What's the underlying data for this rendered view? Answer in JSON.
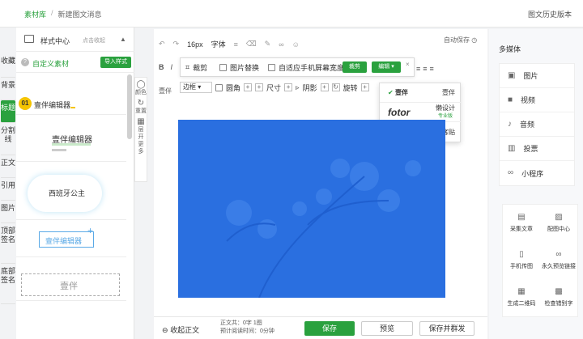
{
  "breadcrumb": {
    "root": "素材库",
    "sep": "/",
    "current": "新建图文消息"
  },
  "history_label": "图文历史版本",
  "left_tabs": [
    "收藏",
    "背景",
    "标题",
    "分割线",
    "正文",
    "引用",
    "图片",
    "顶部签名",
    "底部签名"
  ],
  "active_tab_index": 2,
  "style_panel": {
    "title": "样式中心",
    "collapse_label": "点击收起",
    "custom_label": "自定义素材",
    "import_label": "导入样式",
    "cards": [
      {
        "num": "01",
        "text": "壹伴编辑器"
      },
      {
        "text": "壹伴编辑器"
      },
      {
        "text": "西班牙公主"
      },
      {
        "text": "壹伴编辑器"
      },
      {
        "text": "壹伴"
      }
    ]
  },
  "icon_column": [
    {
      "label": "颜色",
      "icon": "palette-icon"
    },
    {
      "label": "重置",
      "icon": "reset-icon"
    },
    {
      "label": "层开更多",
      "icon": "more-icon"
    }
  ],
  "editor": {
    "autosave_label": "自动保存",
    "toolbar1": [
      "16px",
      "字体"
    ],
    "toolbar2_label": "壹伴",
    "image_toolbar": {
      "crop_label": "裁剪",
      "replace_label": "图片替换",
      "fit_label": "自适应手机屏幕宽度",
      "crop_btn": "裁剪",
      "edit_btn": "编辑"
    },
    "image_toolbar2": {
      "border_label": "边框",
      "round_label": "圆角",
      "size_label": "尺寸",
      "shadow_label": "阴影",
      "rotate_label": "旋转"
    },
    "dropdown": [
      {
        "brand": "壹伴",
        "label": "壹伴"
      },
      {
        "brand": "fotor",
        "label": "懒设计",
        "sub": "专业版"
      },
      {
        "brand": "创客贴logo",
        "label": "创客贴"
      }
    ]
  },
  "bottom_bar": {
    "collapse_text": "收起正文",
    "stats_line1": "正文共：0字 1图",
    "stats_line2": "预计阅读时间：0分钟",
    "save_label": "保存",
    "preview_label": "预览",
    "save_send_label": "保存并群发"
  },
  "right_panel": {
    "media_title": "多媒体",
    "media_items": [
      {
        "label": "图片",
        "icon": "image-icon"
      },
      {
        "label": "视频",
        "icon": "video-icon"
      },
      {
        "label": "音频",
        "icon": "audio-icon"
      },
      {
        "label": "投票",
        "icon": "vote-icon"
      },
      {
        "label": "小程序",
        "icon": "miniprogram-icon"
      }
    ],
    "tools": [
      {
        "label": "采集文章",
        "icon": "collect-icon"
      },
      {
        "label": "配图中心",
        "icon": "gallery-icon"
      },
      {
        "label": "手机传图",
        "icon": "phone-icon"
      },
      {
        "label": "永久预览链接",
        "icon": "link-icon"
      },
      {
        "label": "生成二维码",
        "icon": "qrcode-icon"
      },
      {
        "label": "检查错别字",
        "icon": "spellcheck-icon"
      }
    ]
  },
  "colors": {
    "accent": "#2aa13e",
    "image_blue": "#2a6fe0"
  }
}
